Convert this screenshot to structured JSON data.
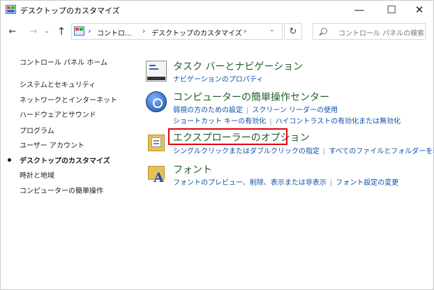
{
  "window": {
    "title": "デスクトップのカスタマイズ",
    "icons": {
      "app": "control-panel-icon",
      "minimize": "minimize-icon",
      "maximize": "maximize-icon",
      "close": "close-icon"
    },
    "controls": {
      "minimize": "—",
      "maximize": "☐",
      "close": "✕"
    }
  },
  "nav": {
    "back": "←",
    "forward": "→",
    "recent": "⌄",
    "up": "↑",
    "address": {
      "crumbs": [
        "コントロ...",
        "デスクトップのカスタマイズ"
      ],
      "separator": "›",
      "dropdown": "⌄"
    },
    "refresh": "↻",
    "search_placeholder": "コントロール パネルの検索"
  },
  "left": {
    "home": "コントロール パネル ホーム",
    "items": [
      "システムとセキュリティ",
      "ネットワークとインターネット",
      "ハードウェアとサウンド",
      "プログラム",
      "ユーザー アカウント",
      "デスクトップのカスタマイズ",
      "時計と地域",
      "コンピューターの簡単操作"
    ],
    "current_index": 5
  },
  "categories": [
    {
      "title": "タスク バーとナビゲーション",
      "icon": "taskbar-icon",
      "links": [
        [
          "ナビゲーションのプロパティ"
        ]
      ]
    },
    {
      "title": "コンピューターの簡単操作センター",
      "icon": "ease-of-access-icon",
      "links": [
        [
          "弱視の方のための設定",
          "スクリーン リーダーの使用"
        ],
        [
          "ショートカット キーの有効化",
          "ハイコントラストの有効化または無効化"
        ]
      ]
    },
    {
      "title": "エクスプローラーのオプション",
      "icon": "explorer-options-icon",
      "links": [
        [
          "シングルクリックまたはダブルクリックの指定",
          "すべてのファイルとフォルダーを表示"
        ]
      ]
    },
    {
      "title": "フォント",
      "icon": "font-icon",
      "links": [
        [
          "フォントのプレビュー、削除、表示または非表示",
          "フォント設定の変更"
        ]
      ]
    }
  ],
  "highlight_color": "#e0000f",
  "link_color": "#0a4fa8",
  "title_color": "#1e5e28"
}
